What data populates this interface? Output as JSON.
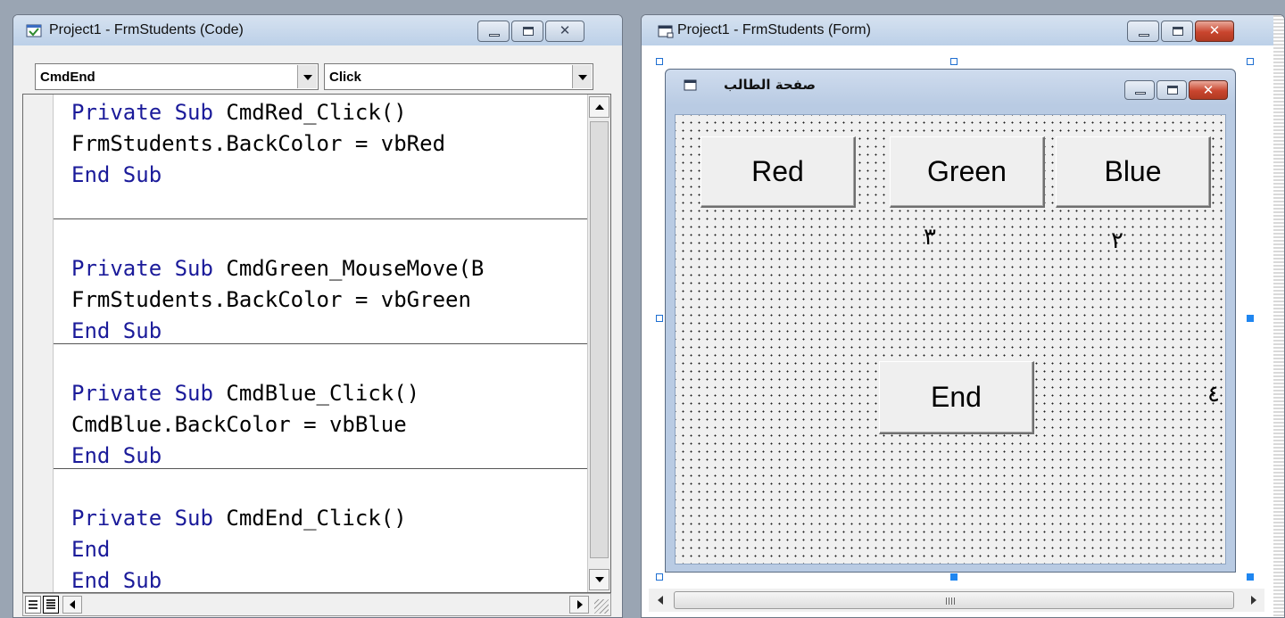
{
  "code_window": {
    "title": "Project1 - FrmStudents (Code)",
    "object_combo": "CmdEnd",
    "procedure_combo": "Click",
    "procedures": [
      {
        "lines": [
          {
            "kw": "Private Sub ",
            "text": "CmdRed_Click()"
          },
          {
            "kw": "",
            "text": "FrmStudents.BackColor = vbRed"
          },
          {
            "kw": "End Sub",
            "text": ""
          }
        ]
      },
      {
        "lines": [
          {
            "kw": "Private Sub ",
            "text": "CmdGreen_MouseMove(B"
          },
          {
            "kw": "",
            "text": "FrmStudents.BackColor = vbGreen"
          },
          {
            "kw": "End Sub",
            "text": ""
          }
        ]
      },
      {
        "lines": [
          {
            "kw": "Private Sub ",
            "text": "CmdBlue_Click()"
          },
          {
            "kw": "",
            "text": "CmdBlue.BackColor = vbBlue"
          },
          {
            "kw": "End Sub",
            "text": ""
          }
        ]
      },
      {
        "lines": [
          {
            "kw": "Private Sub ",
            "text": "CmdEnd_Click()"
          },
          {
            "kw": "End",
            "text": ""
          },
          {
            "kw": "End Sub",
            "text": ""
          }
        ]
      }
    ]
  },
  "form_window": {
    "title": "Project1 - FrmStudents (Form)",
    "inner_form_title": "صفحة الطالب",
    "buttons": {
      "red": "Red",
      "green": "Green",
      "blue": "Blue",
      "end": "End"
    },
    "labels": {
      "three": "٣",
      "two": "٢",
      "four": "٤"
    },
    "scroll_grip": "III"
  },
  "colors": {
    "keyword": "#1b1b9a",
    "code_text": "#000000",
    "close_button": "#c9452e",
    "selection_handle": "#1f86f0"
  }
}
